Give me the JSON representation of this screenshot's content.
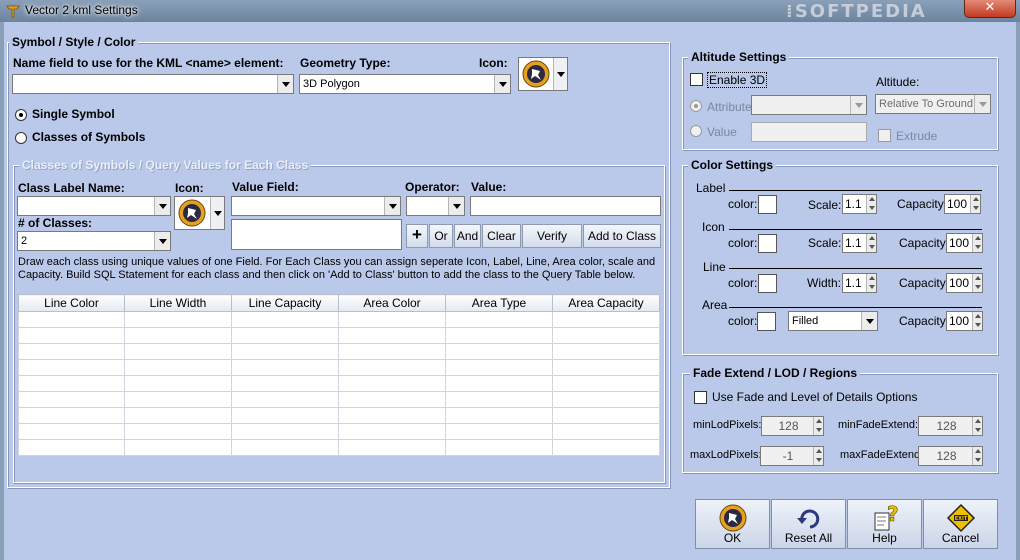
{
  "window": {
    "title": "Vector 2 kml Settings",
    "close_glyph": "✕"
  },
  "symbol_style": {
    "title": "Symbol / Style / Color",
    "name_field_label": "Name field to use for the KML <name> element:",
    "name_field_value": "",
    "geometry_label": "Geometry Type:",
    "geometry_value": "3D Polygon",
    "icon_label": "Icon:",
    "icon": "pushpin-icon",
    "single_symbol": "Single Symbol",
    "classes_of_symbols": "Classes of Symbols",
    "selected_mode": "single"
  },
  "classes": {
    "title": "Classes of Symbols / Query Values for Each Class",
    "class_label_name": "Class Label Name:",
    "class_label_value": "",
    "icon_label": "Icon:",
    "value_field_label": "Value Field:",
    "value_field_value": "",
    "operator_label": "Operator:",
    "operator_value": "",
    "value_label": "Value:",
    "value_value": "",
    "num_classes_label": "# of Classes:",
    "num_classes_value": "2",
    "buttons": {
      "plus": "+",
      "or": "Or",
      "and": "And",
      "clear": "Clear",
      "verify": "Verify",
      "add_to_class": "Add to Class"
    },
    "instructions": "Draw each class using unique values of one Field. For Each Class you can assign  seperate Icon, Label, Line, Area color, scale and Capacity. Build SQL Statement for each class and then click on 'Add to Class' button to add the class to the Query Table below.",
    "columns": [
      "Line Color",
      "Line Width",
      "Line Capacity",
      "Area Color",
      "Area Type",
      "Area Capacity"
    ]
  },
  "altitude": {
    "title": "Altitude Settings",
    "enable_3d": "Enable 3D",
    "altitude_label": "Altitude:",
    "altitude_mode": "Relative To Ground",
    "attribute_label": "Attribute",
    "value_label": "Value",
    "extrude_label": "Extrude"
  },
  "color_settings": {
    "title": "Color Settings",
    "color_label": "color:",
    "capacity_label": "Capacity:",
    "label": {
      "name": "Label",
      "scale_label": "Scale:",
      "scale": "1.1",
      "capacity": "100"
    },
    "icon": {
      "name": "Icon",
      "scale_label": "Scale:",
      "scale": "1.1",
      "capacity": "100"
    },
    "line": {
      "name": "Line",
      "width_label": "Width:",
      "width": "1.1",
      "capacity": "100"
    },
    "area": {
      "name": "Area",
      "fill": "Filled",
      "capacity": "100"
    }
  },
  "fade": {
    "title": "Fade Extend / LOD / Regions",
    "use_fade": "Use Fade and Level of Details Options",
    "min_lod_label": "minLodPixels:",
    "min_lod": "128",
    "min_fade_label": "minFadeExtend:",
    "min_fade": "128",
    "max_lod_label": "maxLodPixels:",
    "max_lod": "-1",
    "max_fade_label": "maxFadeExtend:",
    "max_fade": "128"
  },
  "actions": {
    "ok": "OK",
    "reset_all": "Reset All",
    "help": "Help",
    "cancel": "Cancel"
  },
  "watermark": "SOFTPEDIA"
}
